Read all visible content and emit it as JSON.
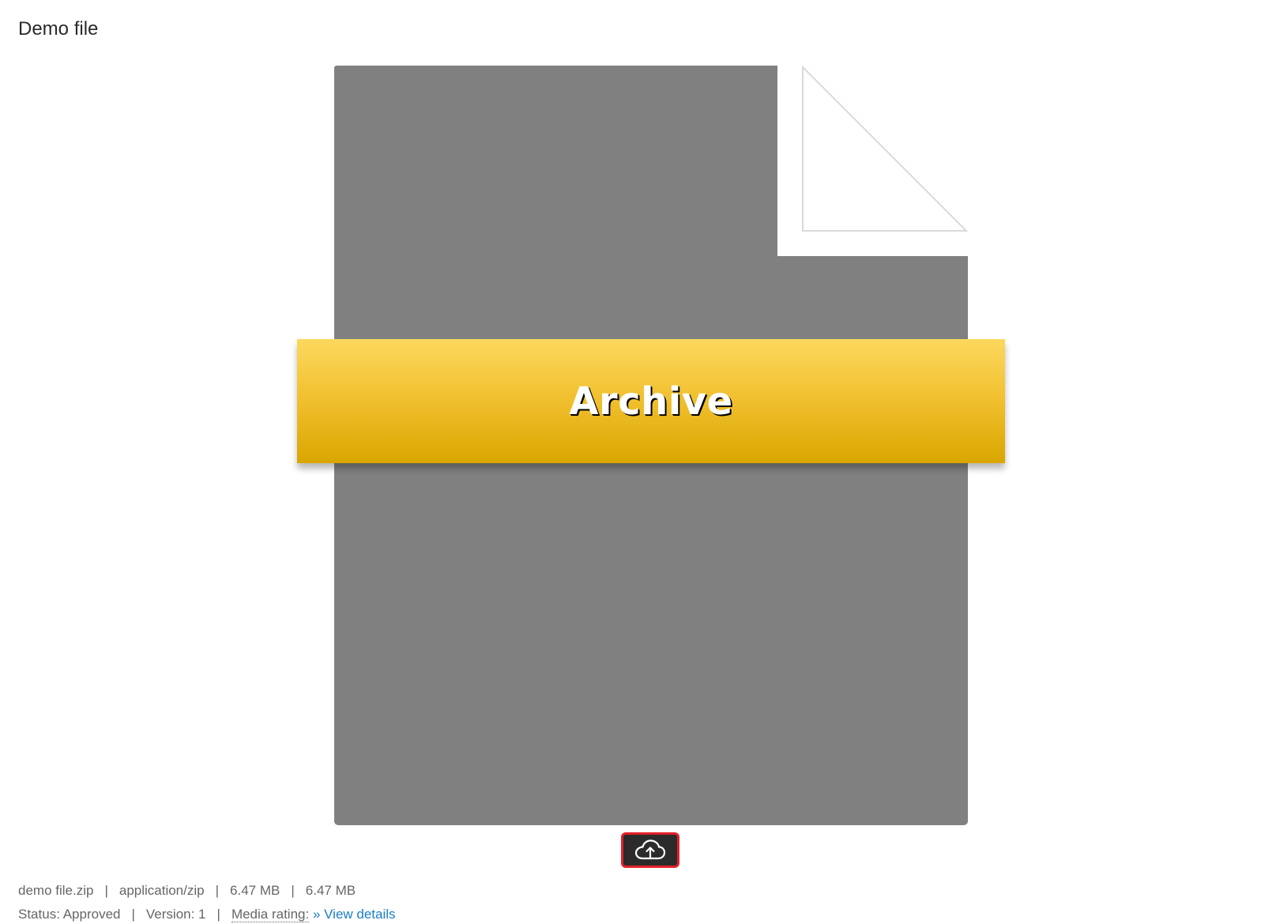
{
  "page": {
    "title": "Demo file"
  },
  "preview": {
    "banner_label": "Archive",
    "colors": {
      "file_body": "#808080",
      "banner_top": "#fdd85e",
      "banner_bottom": "#d9a600",
      "upload_highlight": "#e3202a"
    }
  },
  "upload_button": {
    "icon": "cloud-upload-icon"
  },
  "file_info": {
    "filename": "demo file.zip",
    "mime_type": "application/zip",
    "size_1": "6.47 MB",
    "size_2": "6.47 MB",
    "separator": "|"
  },
  "status_info": {
    "status": "Status: Approved",
    "version": "Version: 1",
    "media_rating_label": "Media rating:",
    "view_details_link": "» View details",
    "separator": "|"
  }
}
